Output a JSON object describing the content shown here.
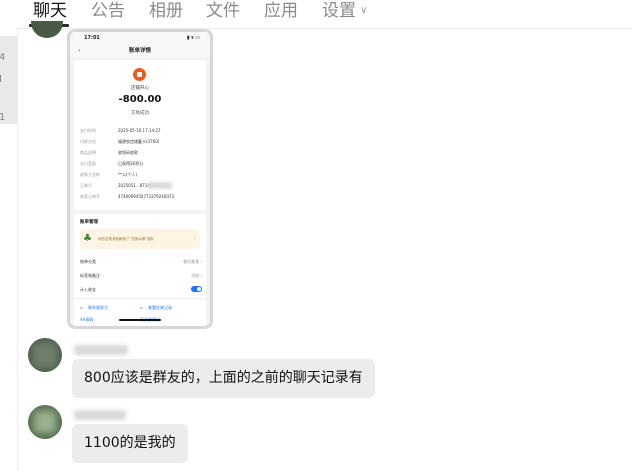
{
  "tabs": [
    {
      "label": "聊天",
      "active": true
    },
    {
      "label": "公告"
    },
    {
      "label": "相册"
    },
    {
      "label": "文件"
    },
    {
      "label": "应用"
    },
    {
      "label": "设置"
    }
  ],
  "left_glyphs": [
    "4",
    "I",
    "1"
  ],
  "receipt": {
    "status_time": "17:01",
    "status_icons": "▮ ▾ ▭",
    "nav_title": "账单详情",
    "merchant": "店铺开心",
    "amount": "-800.00",
    "result": "交易成功",
    "rows": [
      {
        "label": "支付时间",
        "value": "2025-05-10 17:14:27"
      },
      {
        "label": "付款方式",
        "value": "福建农信储蓄卡(3760)"
      },
      {
        "label": "商品说明",
        "value": "收钱码收款"
      },
      {
        "label": "支付奖励",
        "value": "已获得26积分"
      },
      {
        "label": "收款方全称",
        "value": "**公(个人)"
      },
      {
        "label": "订单号",
        "value": "2025051...87140693086"
      },
      {
        "label": "商家订单号",
        "value": "4740069450773279240073"
      }
    ],
    "manage_title": "账单管理",
    "banner_text": "你的这笔消费解锁了“兑换水果”福利",
    "banner_chevron": "›",
    "options": [
      {
        "label": "账单分类",
        "value": "餐饮美食 ›"
      },
      {
        "label": "标签和备注",
        "value": "添加 ›"
      },
      {
        "label": "计入收支",
        "value": ""
      }
    ],
    "footer_left": "联系收款方",
    "footer_right": "查看往来记录",
    "footer_cut_left": "AA收款",
    "footer_cut_right": "打开收款记"
  },
  "messages": [
    {
      "text": "800应该是群友的，上面的之前的聊天记录有"
    },
    {
      "text": "1100的是我的"
    }
  ],
  "colors": {
    "bubble": "#ececec",
    "accent": "#1677ff",
    "merchant_icon": "#f05a1a"
  }
}
